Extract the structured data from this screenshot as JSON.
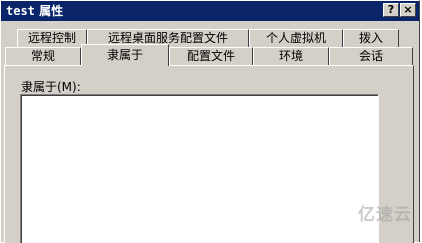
{
  "window": {
    "title_part1": "test",
    "title_part2": "属性",
    "help_button": "?",
    "close_button": "×"
  },
  "tabs_row1": [
    {
      "label": "远程控制"
    },
    {
      "label": "远程桌面服务配置文件"
    },
    {
      "label": "个人虚拟机"
    },
    {
      "label": "拨入"
    }
  ],
  "tabs_row2": [
    {
      "label": "常规"
    },
    {
      "label": "隶属于"
    },
    {
      "label": "配置文件"
    },
    {
      "label": "环境"
    },
    {
      "label": "会话"
    }
  ],
  "active_tab": "隶属于",
  "member_of": {
    "label": "隶属于(M):",
    "items": []
  },
  "watermark": "亿速云"
}
